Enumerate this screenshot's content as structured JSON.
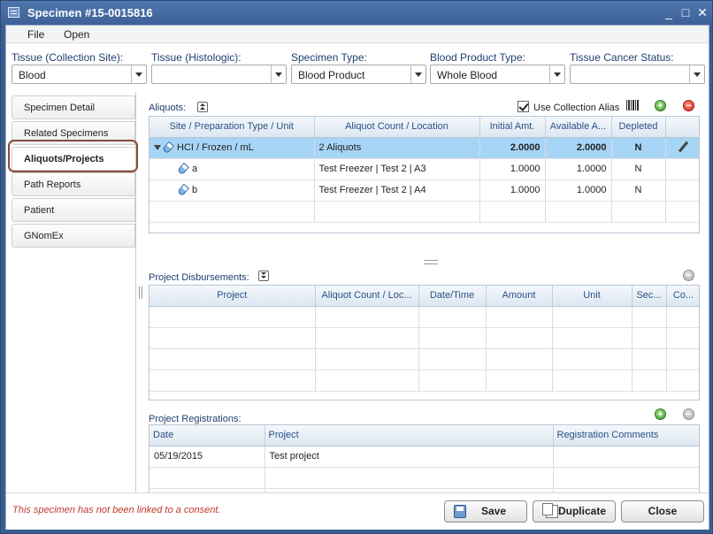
{
  "window": {
    "title": "Specimen #15-0015816",
    "min": "_",
    "max": "□",
    "close": "✕"
  },
  "menu": [
    "File",
    "Open"
  ],
  "filters": [
    {
      "label": "Tissue (Collection Site):",
      "value": "Blood"
    },
    {
      "label": "Tissue (Histologic):",
      "value": ""
    },
    {
      "label": "Specimen Type:",
      "value": "Blood Product"
    },
    {
      "label": "Blood Product Type:",
      "value": "Whole Blood"
    },
    {
      "label": "Tissue Cancer Status:",
      "value": ""
    }
  ],
  "nav": {
    "items": [
      "Specimen Detail",
      "Related Specimens",
      "Aliquots/Projects",
      "Path Reports",
      "Patient",
      "GNomEx"
    ],
    "active": "Aliquots/Projects"
  },
  "aliquots": {
    "label": "Aliquots:",
    "use_alias_label": "Use Collection Alias",
    "use_alias_checked": true,
    "columns": [
      "Site / Preparation Type / Unit",
      "Aliquot Count / Location",
      "Initial Amt.",
      "Available A...",
      "Depleted"
    ],
    "parent": {
      "site": "HCI / Frozen / mL",
      "count": "2 Aliquots",
      "initial": "2.0000",
      "available": "2.0000",
      "depleted": "N"
    },
    "rows": [
      {
        "site": "a",
        "location": "Test Freezer | Test 2 | A3",
        "initial": "1.0000",
        "available": "1.0000",
        "depleted": "N"
      },
      {
        "site": "b",
        "location": "Test Freezer | Test 2 | A4",
        "initial": "1.0000",
        "available": "1.0000",
        "depleted": "N"
      }
    ]
  },
  "disbursements": {
    "label": "Project Disbursements:",
    "columns": [
      "Project",
      "Aliquot Count / Loc...",
      "Date/Time",
      "Amount",
      "Unit",
      "Sec...",
      "Co..."
    ]
  },
  "registrations": {
    "label": "Project Registrations:",
    "columns": [
      "Date",
      "Project",
      "Registration Comments"
    ],
    "rows": [
      {
        "date": "05/19/2015",
        "project": "Test project",
        "comments": ""
      }
    ]
  },
  "footer": {
    "warning": "This specimen has not been linked to a consent.",
    "save": "Save",
    "duplicate": "Duplicate",
    "close": "Close"
  }
}
